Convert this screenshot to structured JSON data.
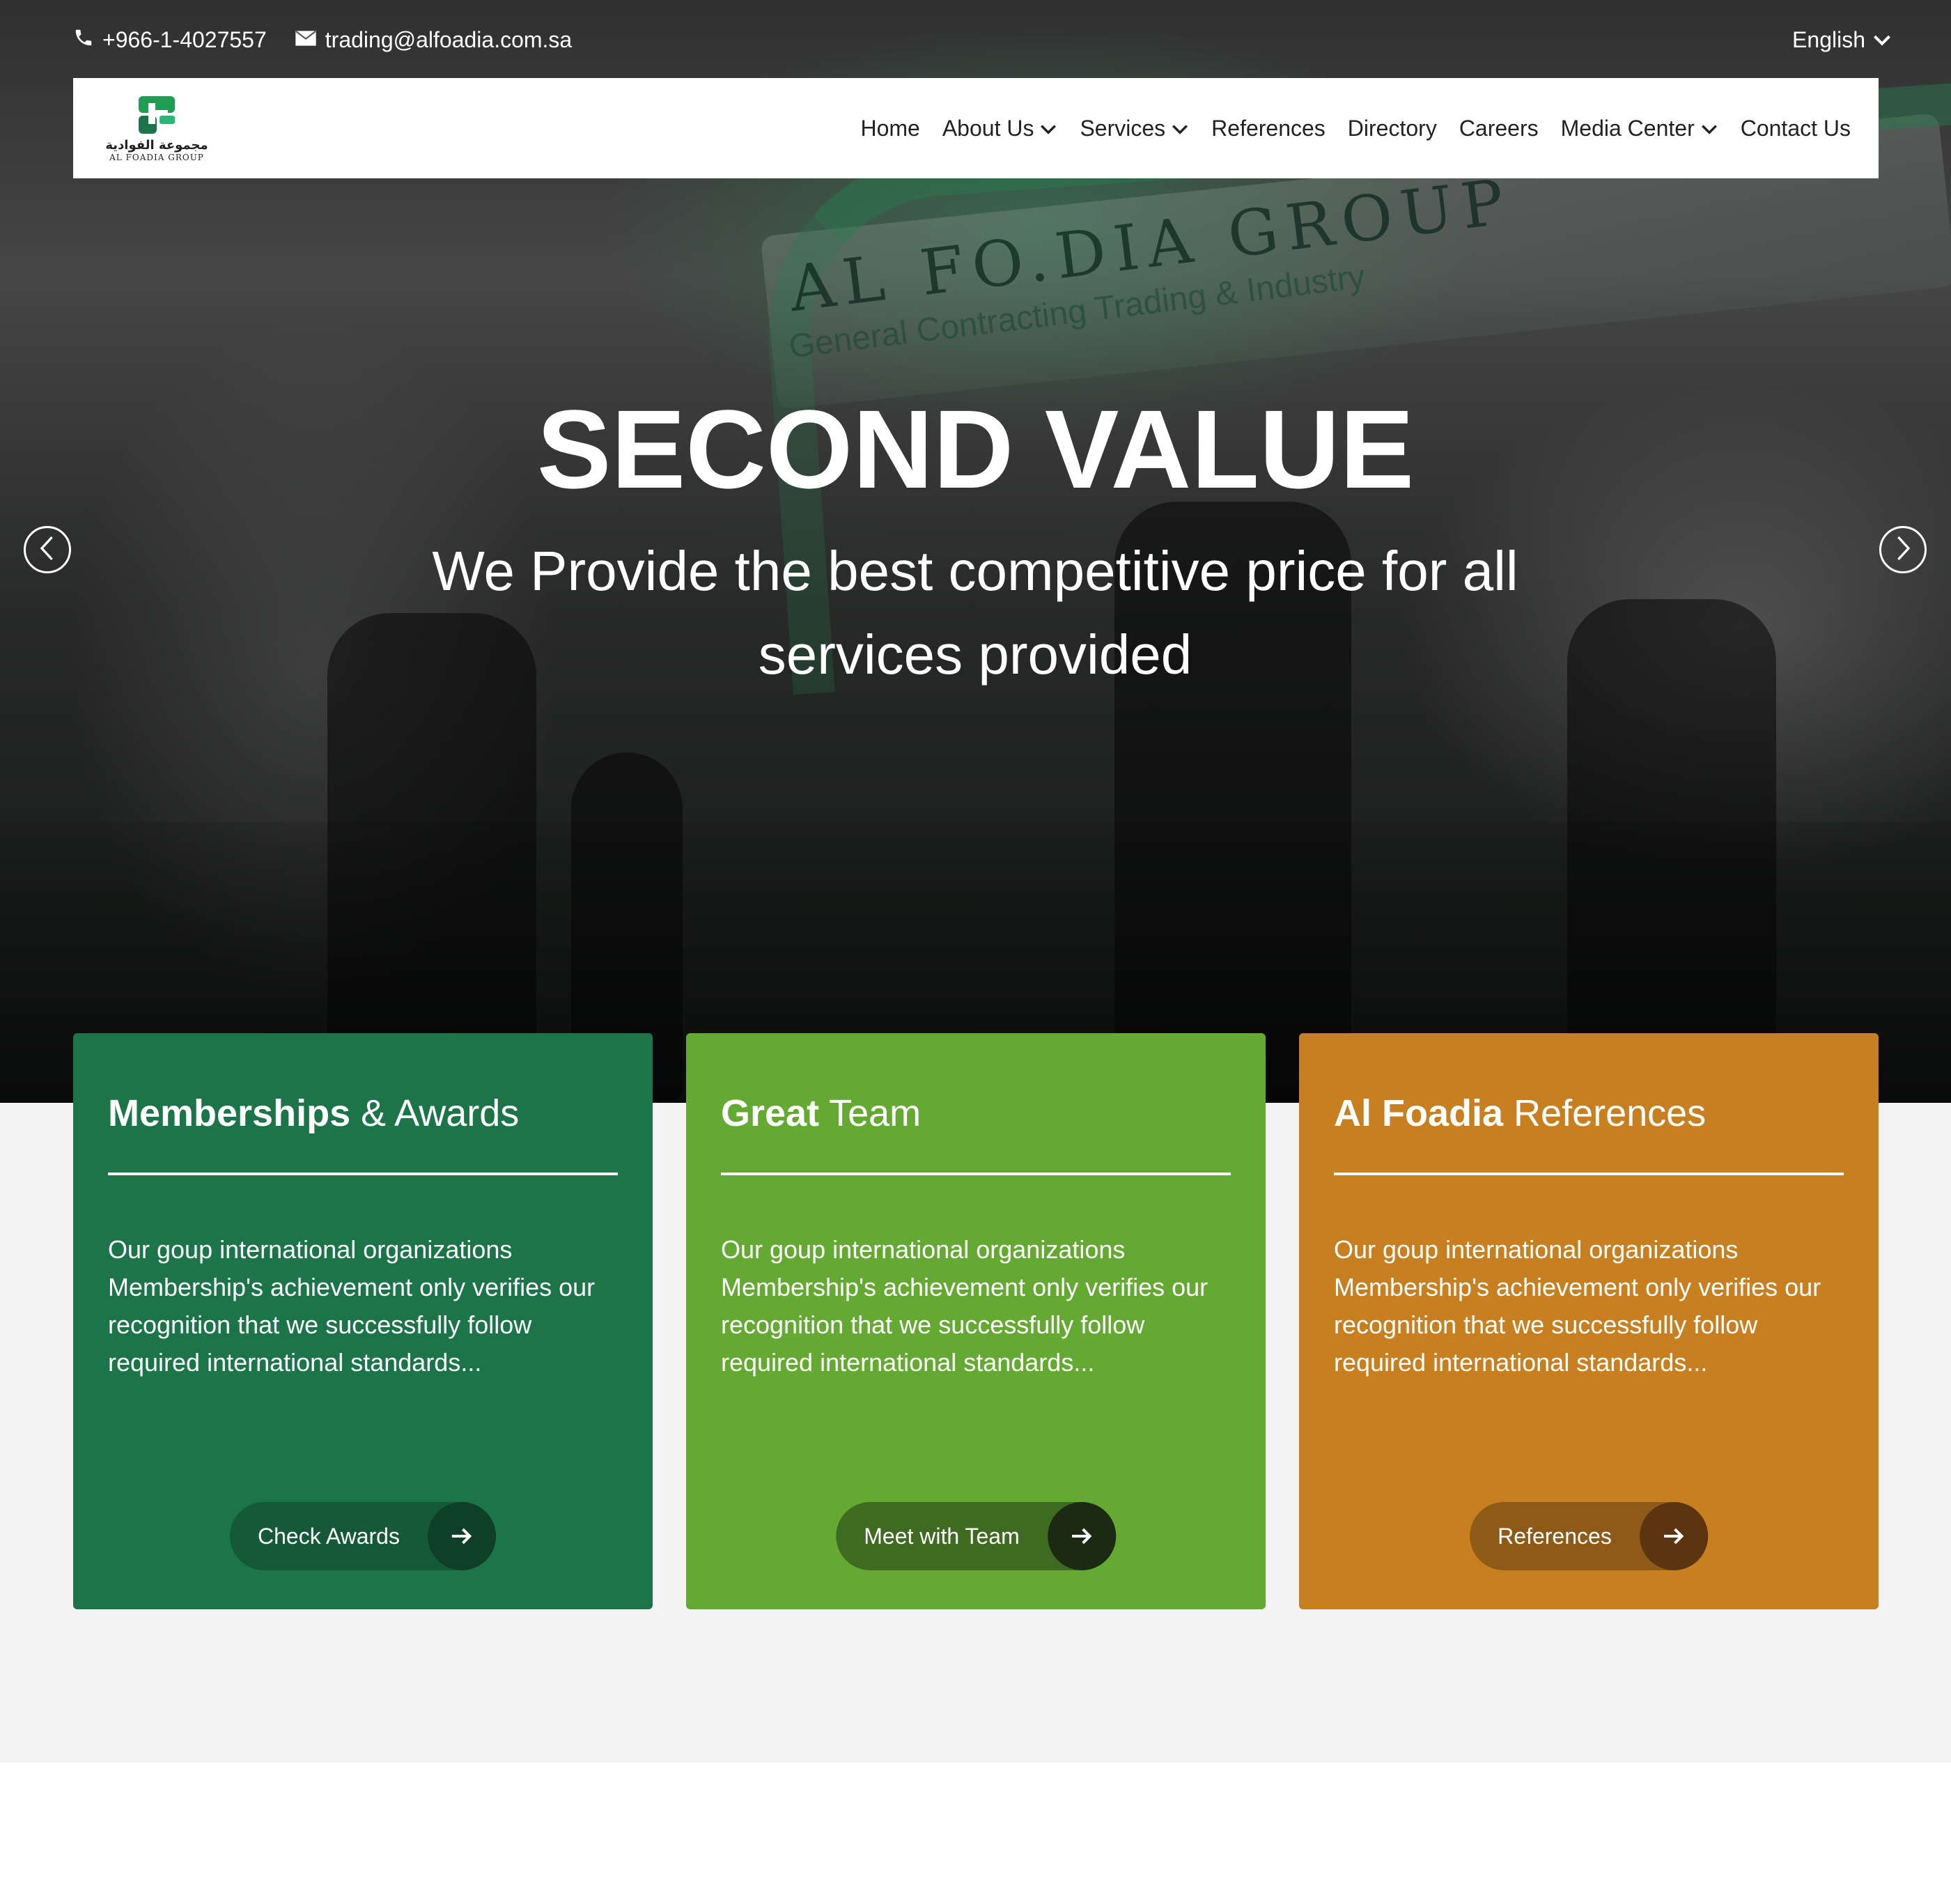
{
  "topbar": {
    "phone": "+966-1-4027557",
    "email": "trading@alfoadia.com.sa",
    "language": "English"
  },
  "logo": {
    "arabic": "مجموعة الفوادية",
    "english": "AL FOADIA GROUP"
  },
  "nav": {
    "home": "Home",
    "about": "About Us",
    "services": "Services",
    "references": "References",
    "directory": "Directory",
    "careers": "Careers",
    "media": "Media Center",
    "contact": "Contact Us"
  },
  "hero": {
    "title": "SECOND VALUE",
    "subtitle": "We Provide the best competitive price for all services provided",
    "sign_text": "AL FO.DIA GROUP",
    "sign_sub": "General Contracting Trading & Industry"
  },
  "cards": [
    {
      "title_bold": "Memberships",
      "title_light": " & Awards",
      "text": "Our goup international organizations Membership's achievement only verifies our recognition that we successfully follow required international standards...",
      "button": "Check Awards",
      "color": "#1b7549",
      "btn_color": "#145a37",
      "arrow_color": "#0f3f27"
    },
    {
      "title_bold": "Great",
      "title_light": " Team",
      "text": "Our goup international organizations Membership's achievement only verifies our recognition that we successfully follow required international standards...",
      "button": "Meet with Team",
      "color": "#64aa32",
      "btn_color": "#3e6a21",
      "arrow_color": "#1c2a14"
    },
    {
      "title_bold": "Al Foadia",
      "title_light": " References",
      "text": "Our goup international organizations Membership's achievement only verifies our recognition that we successfully follow required international standards...",
      "button": "References",
      "color": "#c77f20",
      "btn_color": "#8e5a18",
      "arrow_color": "#5a3510"
    }
  ],
  "colors": {
    "brand_green": "#1b7549",
    "light_gray": "#f5f4f4"
  }
}
